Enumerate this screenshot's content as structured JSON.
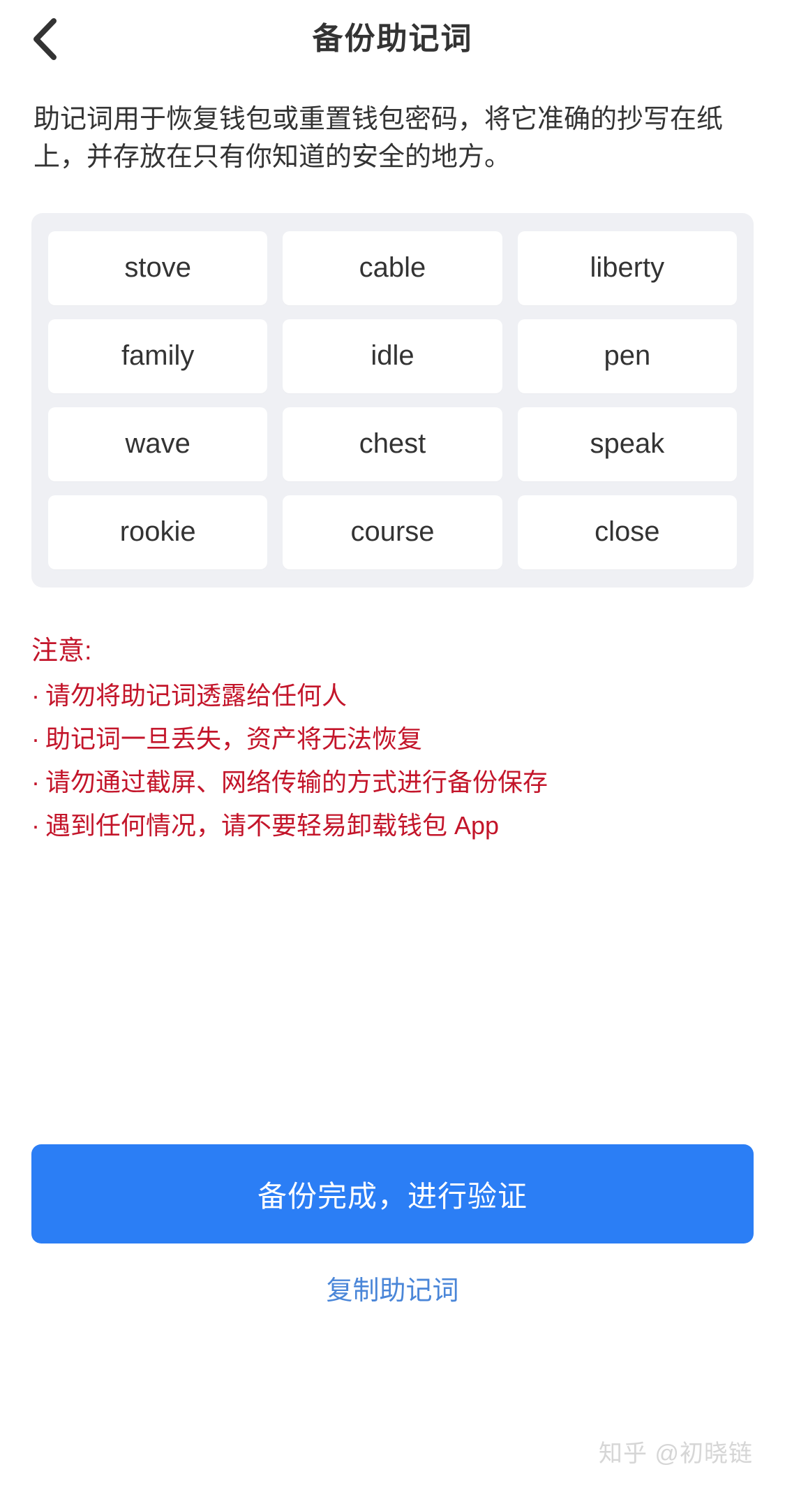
{
  "header": {
    "back_icon": "chevron-left-icon",
    "title": "备份助记词"
  },
  "description": "助记词用于恢复钱包或重置钱包密码，将它准确的抄写在纸上，并存放在只有你知道的安全的地方。",
  "mnemonic": {
    "words": [
      "stove",
      "cable",
      "liberty",
      "family",
      "idle",
      "pen",
      "wave",
      "chest",
      "speak",
      "rookie",
      "course",
      "close"
    ]
  },
  "warning": {
    "title": "注意:",
    "bullet": "·",
    "items": [
      "请勿将助记词透露给任何人",
      "助记词一旦丢失，资产将无法恢复",
      "请勿通过截屏、网络传输的方式进行备份保存",
      "遇到任何情况，请不要轻易卸载钱包 App"
    ]
  },
  "actions": {
    "primary_label": "备份完成，进行验证",
    "secondary_label": "复制助记词"
  },
  "watermark": "知乎 @初晓链",
  "colors": {
    "primary": "#2b7ef5",
    "link": "#4a86d8",
    "warning": "#c3152a",
    "panel_bg": "#eff0f4",
    "text": "#333333"
  }
}
